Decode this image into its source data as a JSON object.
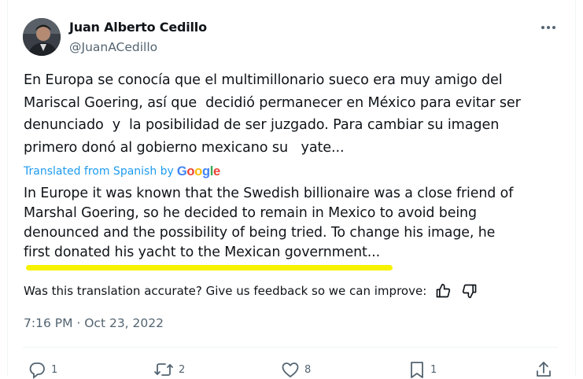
{
  "author": {
    "name": "Juan Alberto Cedillo",
    "handle": "@JuanACedillo"
  },
  "tweet": {
    "text": "En Europa se conocía que el multimillonario sueco era muy amigo del\nMariscal Goering, así que  decidió permanecer en México para evitar ser\ndenunciado  y  la posibilidad de ser juzgado. Para cambiar su imagen\nprimero donó al gobierno mexicano su   yate...",
    "translated_label": "Translated from Spanish by",
    "translated_provider": "Google",
    "translation": "In Europe it was known that the Swedish billionaire was a close friend of\nMarshal Goering, so he decided to remain in Mexico to avoid being\ndenounced and the possibility of being tried. To change his image, he\nfirst donated his yacht to the Mexican government...",
    "feedback_prompt": "Was this translation accurate? Give us feedback so we can improve:",
    "timestamp": "7:16 PM · Oct 23, 2022"
  },
  "actions": {
    "replies": "1",
    "retweets": "2",
    "likes": "8",
    "bookmarks": "1"
  },
  "colors": {
    "link": "#1d9bf0",
    "secondary_text": "#536471",
    "highlight": "#f6f200"
  },
  "icons": [
    "more-icon",
    "thumbs-up-icon",
    "thumbs-down-icon",
    "reply-icon",
    "retweet-icon",
    "like-icon",
    "bookmark-icon",
    "share-icon"
  ]
}
